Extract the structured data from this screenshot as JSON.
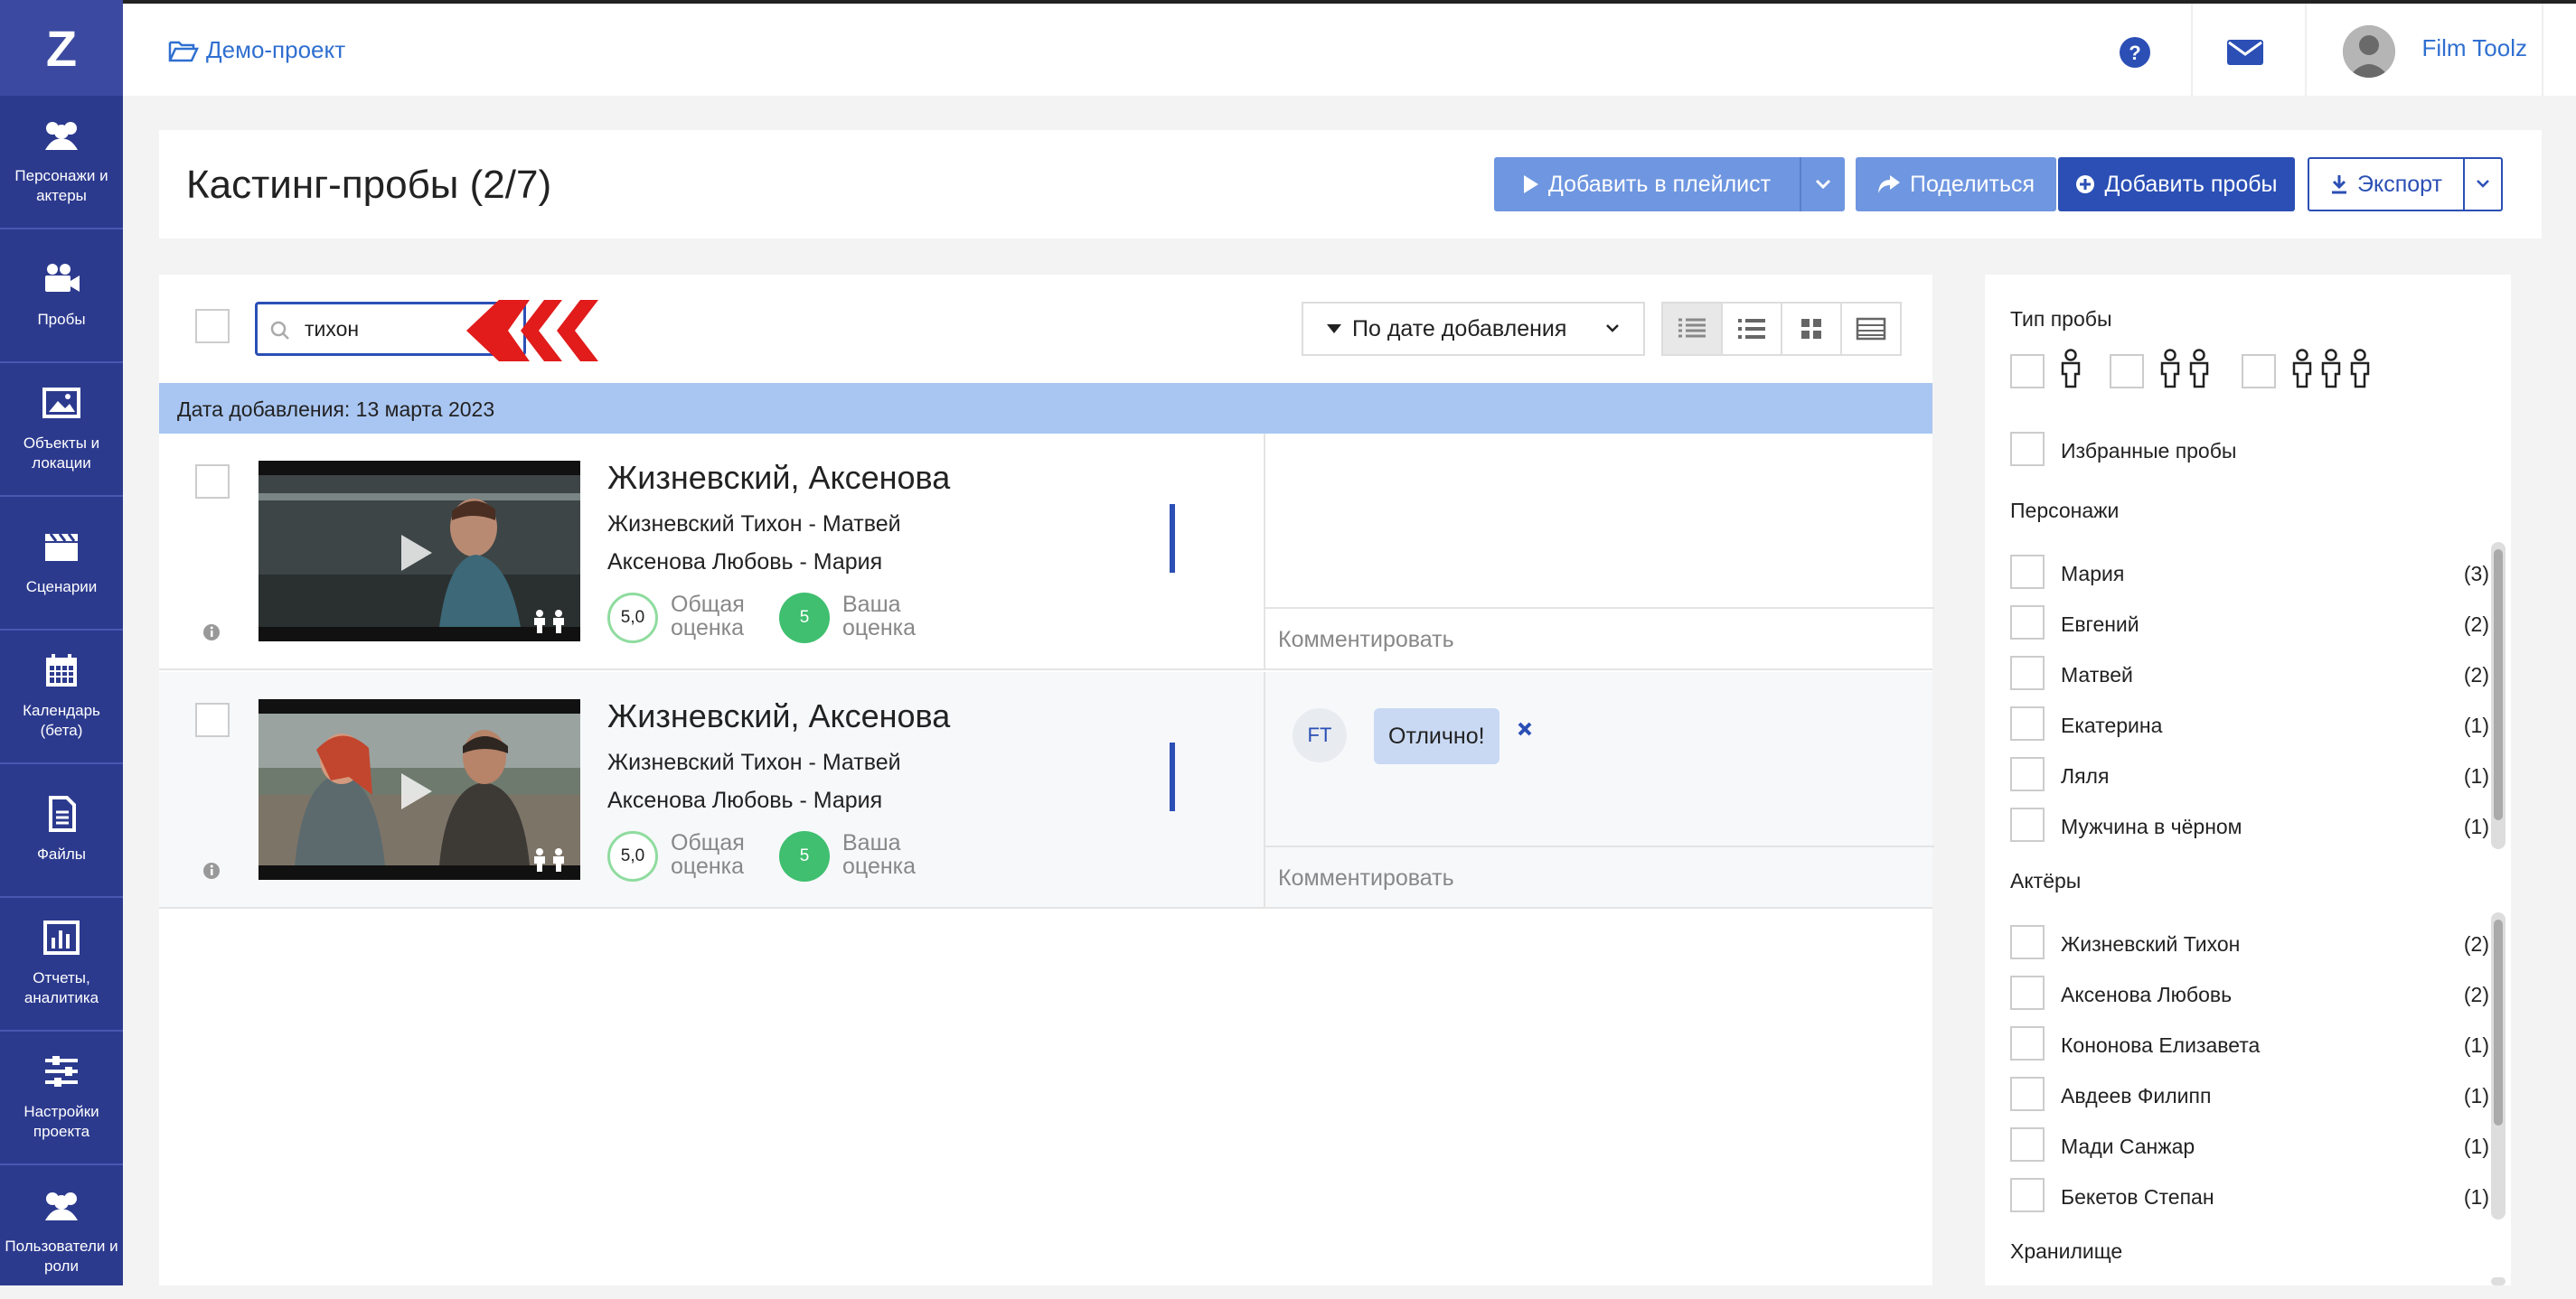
{
  "sidebar": {
    "logo": "Z",
    "items": [
      {
        "label": "Персонажи и актеры",
        "icon": "users-icon"
      },
      {
        "label": "Пробы",
        "icon": "video-camera-icon"
      },
      {
        "label": "Объекты и локации",
        "icon": "image-icon"
      },
      {
        "label": "Сценарии",
        "icon": "clapperboard-icon"
      },
      {
        "label": "Календарь (бета)",
        "icon": "calendar-icon"
      },
      {
        "label": "Файлы",
        "icon": "file-icon"
      },
      {
        "label": "Отчеты, аналитика",
        "icon": "chart-icon"
      },
      {
        "label": "Настройки проекта",
        "icon": "sliders-icon"
      },
      {
        "label": "Пользователи и роли",
        "icon": "users-icon"
      }
    ]
  },
  "topbar": {
    "breadcrumb": "Демо-проект",
    "user_name": "Film Toolz"
  },
  "header": {
    "title": "Кастинг-пробы (2/7)",
    "add_to_playlist": "Добавить в плейлист",
    "share": "Поделиться",
    "add_takes": "Добавить пробы",
    "export": "Экспорт"
  },
  "list": {
    "search_value": "тихон",
    "sort_label": "По дате добавления",
    "date_group": "Дата добавления: 13 марта 2023",
    "rows": [
      {
        "title": "Жизневский, Аксенова",
        "line1": "Жизневский Тихон - Матвей",
        "line2": "Аксенова Любовь - Мария",
        "overall_score": "5,0",
        "overall_label1": "Общая",
        "overall_label2": "оценка",
        "your_score": "5",
        "your_label1": "Ваша",
        "your_label2": "оценка",
        "comment": "",
        "comment_placeholder": "Комментировать"
      },
      {
        "title": "Жизневский, Аксенова",
        "line1": "Жизневский Тихон - Матвей",
        "line2": "Аксенова Любовь - Мария",
        "overall_score": "5,0",
        "overall_label1": "Общая",
        "overall_label2": "оценка",
        "your_score": "5",
        "your_label1": "Ваша",
        "your_label2": "оценка",
        "comment_author": "FT",
        "comment": "Отлично!",
        "comment_placeholder": "Комментировать"
      }
    ]
  },
  "filters": {
    "take_type_label": "Тип пробы",
    "favorites": "Избранные пробы",
    "characters_label": "Персонажи",
    "characters": [
      {
        "name": "Мария",
        "count": "(3)"
      },
      {
        "name": "Евгений",
        "count": "(2)"
      },
      {
        "name": "Матвей",
        "count": "(2)"
      },
      {
        "name": "Екатерина",
        "count": "(1)"
      },
      {
        "name": "Ляля",
        "count": "(1)"
      },
      {
        "name": "Мужчина в чёрном",
        "count": "(1)"
      }
    ],
    "actors_label": "Актёры",
    "actors": [
      {
        "name": "Жизневский Тихон",
        "count": "(2)"
      },
      {
        "name": "Аксенова Любовь",
        "count": "(2)"
      },
      {
        "name": "Кононова Елизавета",
        "count": "(1)"
      },
      {
        "name": "Авдеев Филипп",
        "count": "(1)"
      },
      {
        "name": "Мади Санжар",
        "count": "(1)"
      },
      {
        "name": "Бекетов Степан",
        "count": "(1)"
      }
    ],
    "storage_label": "Хранилище"
  },
  "colors": {
    "sidebar": "#2c3a8e",
    "primary": "#2b4fb5",
    "light_button": "#6f96e0",
    "date_bar": "#a9c6f2",
    "score_green": "#3fbf6f"
  }
}
